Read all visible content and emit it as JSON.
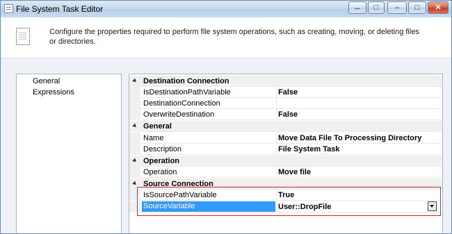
{
  "window": {
    "title": "File System Task Editor",
    "controls": {
      "switch_label": "↔",
      "minimize_label": "–",
      "restore_label": "□",
      "close_label": "✕"
    }
  },
  "header": {
    "description": "Configure the properties required to perform file system operations, such as creating, moving, or deleting files or directories.",
    "icon": "document-icon"
  },
  "nav": {
    "items": [
      {
        "label": "General"
      },
      {
        "label": "Expressions"
      }
    ]
  },
  "grid": {
    "categories": [
      {
        "label": "Destination Connection"
      },
      {
        "label": "General"
      },
      {
        "label": "Operation"
      },
      {
        "label": "Source Connection"
      }
    ],
    "rows": [
      {
        "name": "IsDestinationPathVariable",
        "value": "False"
      },
      {
        "name": "DestinationConnection",
        "value": ""
      },
      {
        "name": "OverwriteDestination",
        "value": "False"
      },
      {
        "name": "Name",
        "value": "Move Data File To Processing Directory"
      },
      {
        "name": "Description",
        "value": "File System Task"
      },
      {
        "name": "Operation",
        "value": "Move file"
      },
      {
        "name": "IsSourcePathVariable",
        "value": "True"
      },
      {
        "name": "SourceVariable",
        "value": "User::DropFile"
      }
    ]
  },
  "colors": {
    "selection": "#3399ff",
    "highlight_box": "#dd2222",
    "window_bg": "#eef2f7"
  }
}
